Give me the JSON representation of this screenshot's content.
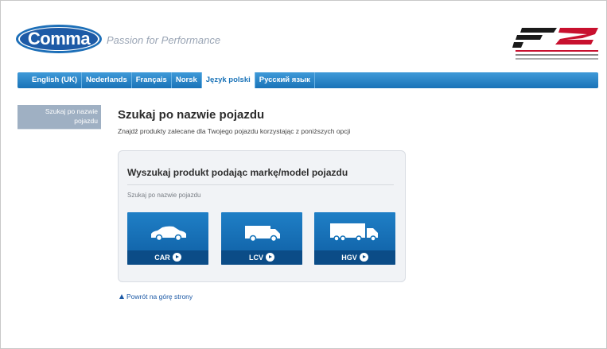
{
  "brand": {
    "logo_text": "Comma",
    "tagline": "Passion for Performance",
    "partner_logo": "F2 FIA Formula Two Championship Technical Partner"
  },
  "nav": {
    "items": [
      {
        "label": "English (UK)"
      },
      {
        "label": "Nederlands"
      },
      {
        "label": "Français"
      },
      {
        "label": "Norsk"
      },
      {
        "label": "Język polski",
        "active": true
      },
      {
        "label": "Русский язык"
      }
    ]
  },
  "sidebar": {
    "items": [
      {
        "label": "Szukaj po nazwie pojazdu"
      }
    ]
  },
  "main": {
    "title": "Szukaj po nazwie pojazdu",
    "intro": "Znajdź produkty zalecane dla Twojego pojazdu korzystając z poniższych opcji",
    "panel": {
      "title": "Wyszukaj produkt podając markę/model pojazdu",
      "subtitle": "Szukaj po nazwie pojazdu",
      "buttons": [
        {
          "label": "CAR",
          "icon": "car-icon"
        },
        {
          "label": "LCV",
          "icon": "van-icon"
        },
        {
          "label": "HGV",
          "icon": "truck-icon"
        }
      ]
    },
    "back_to_top": "Powrót na górę strony"
  },
  "colors": {
    "brand_blue": "#1d5aa6",
    "nav_blue": "#1a73b8",
    "sidebar_grey": "#9fb0c3"
  }
}
